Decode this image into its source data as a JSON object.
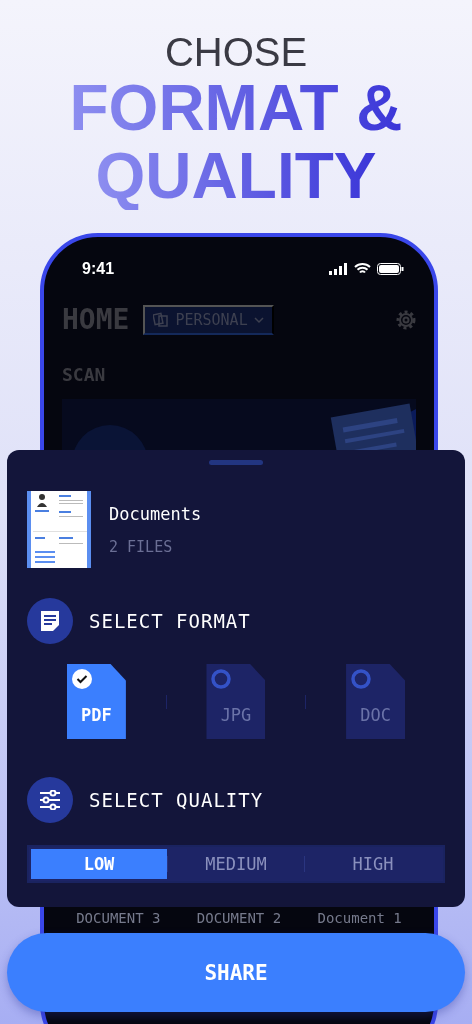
{
  "headline": {
    "line1": "CHOSE",
    "line2": "FORMAT &",
    "line3": "QUALITY"
  },
  "status_bar": {
    "time": "9:41"
  },
  "home": {
    "title": "HOME",
    "workspace": "PERSONAL",
    "section": "SCAN",
    "documents": [
      {
        "name": "DOCUMENT 3"
      },
      {
        "name": "DOCUMENT 2"
      },
      {
        "name": "Document 1"
      }
    ]
  },
  "sheet": {
    "file": {
      "name": "Documents",
      "count": "2 FILES"
    },
    "format_title": "SELECT FORMAT",
    "formats": [
      {
        "label": "PDF",
        "selected": true
      },
      {
        "label": "JPG",
        "selected": false
      },
      {
        "label": "DOC",
        "selected": false
      }
    ],
    "quality_title": "SELECT QUALITY",
    "qualities": [
      {
        "label": "LOW",
        "selected": true
      },
      {
        "label": "MEDIUM",
        "selected": false
      },
      {
        "label": "HIGH",
        "selected": false
      }
    ]
  },
  "share_button": "SHARE"
}
